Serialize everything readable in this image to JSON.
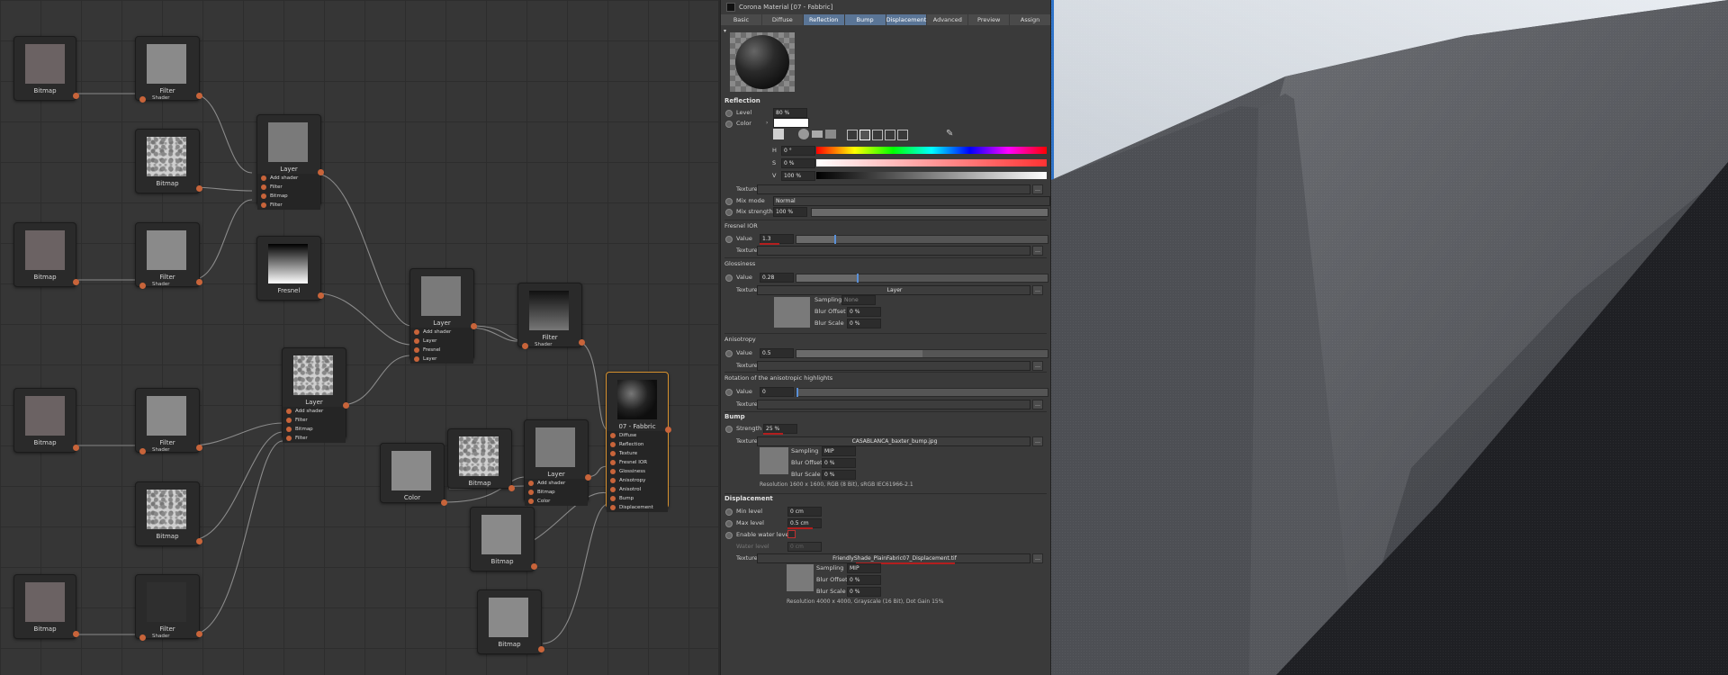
{
  "editor": {
    "nodes": [
      {
        "id": "n1",
        "title": "Bitmap"
      },
      {
        "id": "n2",
        "title": "Filter",
        "port": "Shader"
      },
      {
        "id": "n3",
        "title": "Bitmap"
      },
      {
        "id": "n4",
        "title": "Layer",
        "ports": [
          "Add shader",
          "Filter",
          "Bitmap",
          "Filter"
        ]
      },
      {
        "id": "n5",
        "title": "Bitmap"
      },
      {
        "id": "n6",
        "title": "Filter",
        "port": "Shader"
      },
      {
        "id": "n7",
        "title": "Fresnel"
      },
      {
        "id": "n8",
        "title": "Layer",
        "ports": [
          "Add shader",
          "Layer",
          "Fresnel",
          "Layer"
        ]
      },
      {
        "id": "n9",
        "title": "Filter",
        "port": "Shader"
      },
      {
        "id": "n10",
        "title": "Layer",
        "ports": [
          "Add shader",
          "Filter",
          "Bitmap",
          "Filter"
        ]
      },
      {
        "id": "n11",
        "title": "Bitmap"
      },
      {
        "id": "n12",
        "title": "Filter",
        "port": "Shader"
      },
      {
        "id": "n13",
        "title": "07 - Fabbric",
        "ports": [
          "Diffuse",
          "Reflection",
          "Texture",
          "Fresnel IOR",
          "Glossiness",
          "Anisotropy",
          "Anisotrol",
          "Bump",
          "Displacement"
        ]
      },
      {
        "id": "n14",
        "title": "Bitmap"
      },
      {
        "id": "n15",
        "title": "Color"
      },
      {
        "id": "n16",
        "title": "Bitmap"
      },
      {
        "id": "n17",
        "title": "Layer",
        "ports": [
          "Add shader",
          "Bitmap",
          "Color"
        ]
      },
      {
        "id": "n18",
        "title": "Bitmap"
      },
      {
        "id": "n19",
        "title": "Bitmap"
      },
      {
        "id": "n20",
        "title": "Filter",
        "port": "Shader"
      },
      {
        "id": "n21",
        "title": "Bitmap"
      }
    ]
  },
  "panel": {
    "title": "Corona Material [07 - Fabbric]",
    "tabs": [
      "Basic",
      "Diffuse",
      "Reflection",
      "Bump",
      "Displacement",
      "Advanced",
      "Preview",
      "Assign"
    ],
    "active_tabs": [
      "Reflection",
      "Bump",
      "Displacement"
    ],
    "reflection": {
      "heading": "Reflection",
      "level_label": "Level",
      "level_value": "80 %",
      "color_label": "Color",
      "h_label": "H",
      "h_value": "0 °",
      "s_label": "S",
      "s_value": "0 %",
      "v_label": "V",
      "v_value": "100 %",
      "texture_label": "Texture",
      "mix_mode_label": "Mix mode",
      "mix_mode_value": "Normal",
      "mix_strength_label": "Mix strength",
      "mix_strength_value": "100 %",
      "fresnel_head": "Fresnel IOR",
      "fresnel_value_label": "Value",
      "fresnel_value": "1.3",
      "fresnel_texture_label": "Texture",
      "gloss_head": "Glossiness",
      "gloss_value_label": "Value",
      "gloss_value": "0.28",
      "gloss_texture_label": "Texture",
      "gloss_texture_value": "Layer",
      "gloss_sampling_label": "Sampling",
      "gloss_sampling_value": "None",
      "gloss_blur_offset_label": "Blur Offset",
      "gloss_blur_offset_value": "0 %",
      "gloss_blur_scale_label": "Blur Scale",
      "gloss_blur_scale_value": "0 %",
      "aniso_head": "Anisotropy",
      "aniso_value_label": "Value",
      "aniso_value": "0.5",
      "aniso_texture_label": "Texture",
      "rot_head": "Rotation of the anisotropic highlights",
      "rot_value_label": "Value",
      "rot_value": "0",
      "rot_texture_label": "Texture"
    },
    "bump": {
      "heading": "Bump",
      "strength_label": "Strength",
      "strength_value": "25 %",
      "texture_label": "Texture",
      "texture_value": "CASABLANCA_baxter_bump.jpg",
      "sampling_label": "Sampling",
      "sampling_value": "MIP",
      "blur_offset_label": "Blur Offset",
      "blur_offset_value": "0 %",
      "blur_scale_label": "Blur Scale",
      "blur_scale_value": "0 %",
      "resolution": "Resolution 1600 x 1600, RGB (8 Bit), sRGB IEC61966-2.1"
    },
    "displacement": {
      "heading": "Displacement",
      "min_label": "Min level",
      "min_value": "0 cm",
      "max_label": "Max level",
      "max_value": "0.5 cm",
      "water_label": "Enable water level",
      "water_level_label": "Water level",
      "water_level_value": "0 cm",
      "texture_label": "Texture",
      "texture_value": "FriendlyShade_PlainFabric07_Displacement.tif",
      "sampling_label": "Sampling",
      "sampling_value": "MIP",
      "blur_offset_label": "Blur Offset",
      "blur_offset_value": "0 %",
      "blur_scale_label": "Blur Scale",
      "blur_scale_value": "0 %",
      "resolution": "Resolution 4000 x 4000, Grayscale (16 Bit), Dot Gain 15%"
    }
  },
  "colors": {
    "accent": "#5a7596",
    "port": "#c8643a",
    "selected": "#d7912e",
    "highlight_underline": "#b41e1e",
    "viewport_border": "#2f73c8"
  }
}
